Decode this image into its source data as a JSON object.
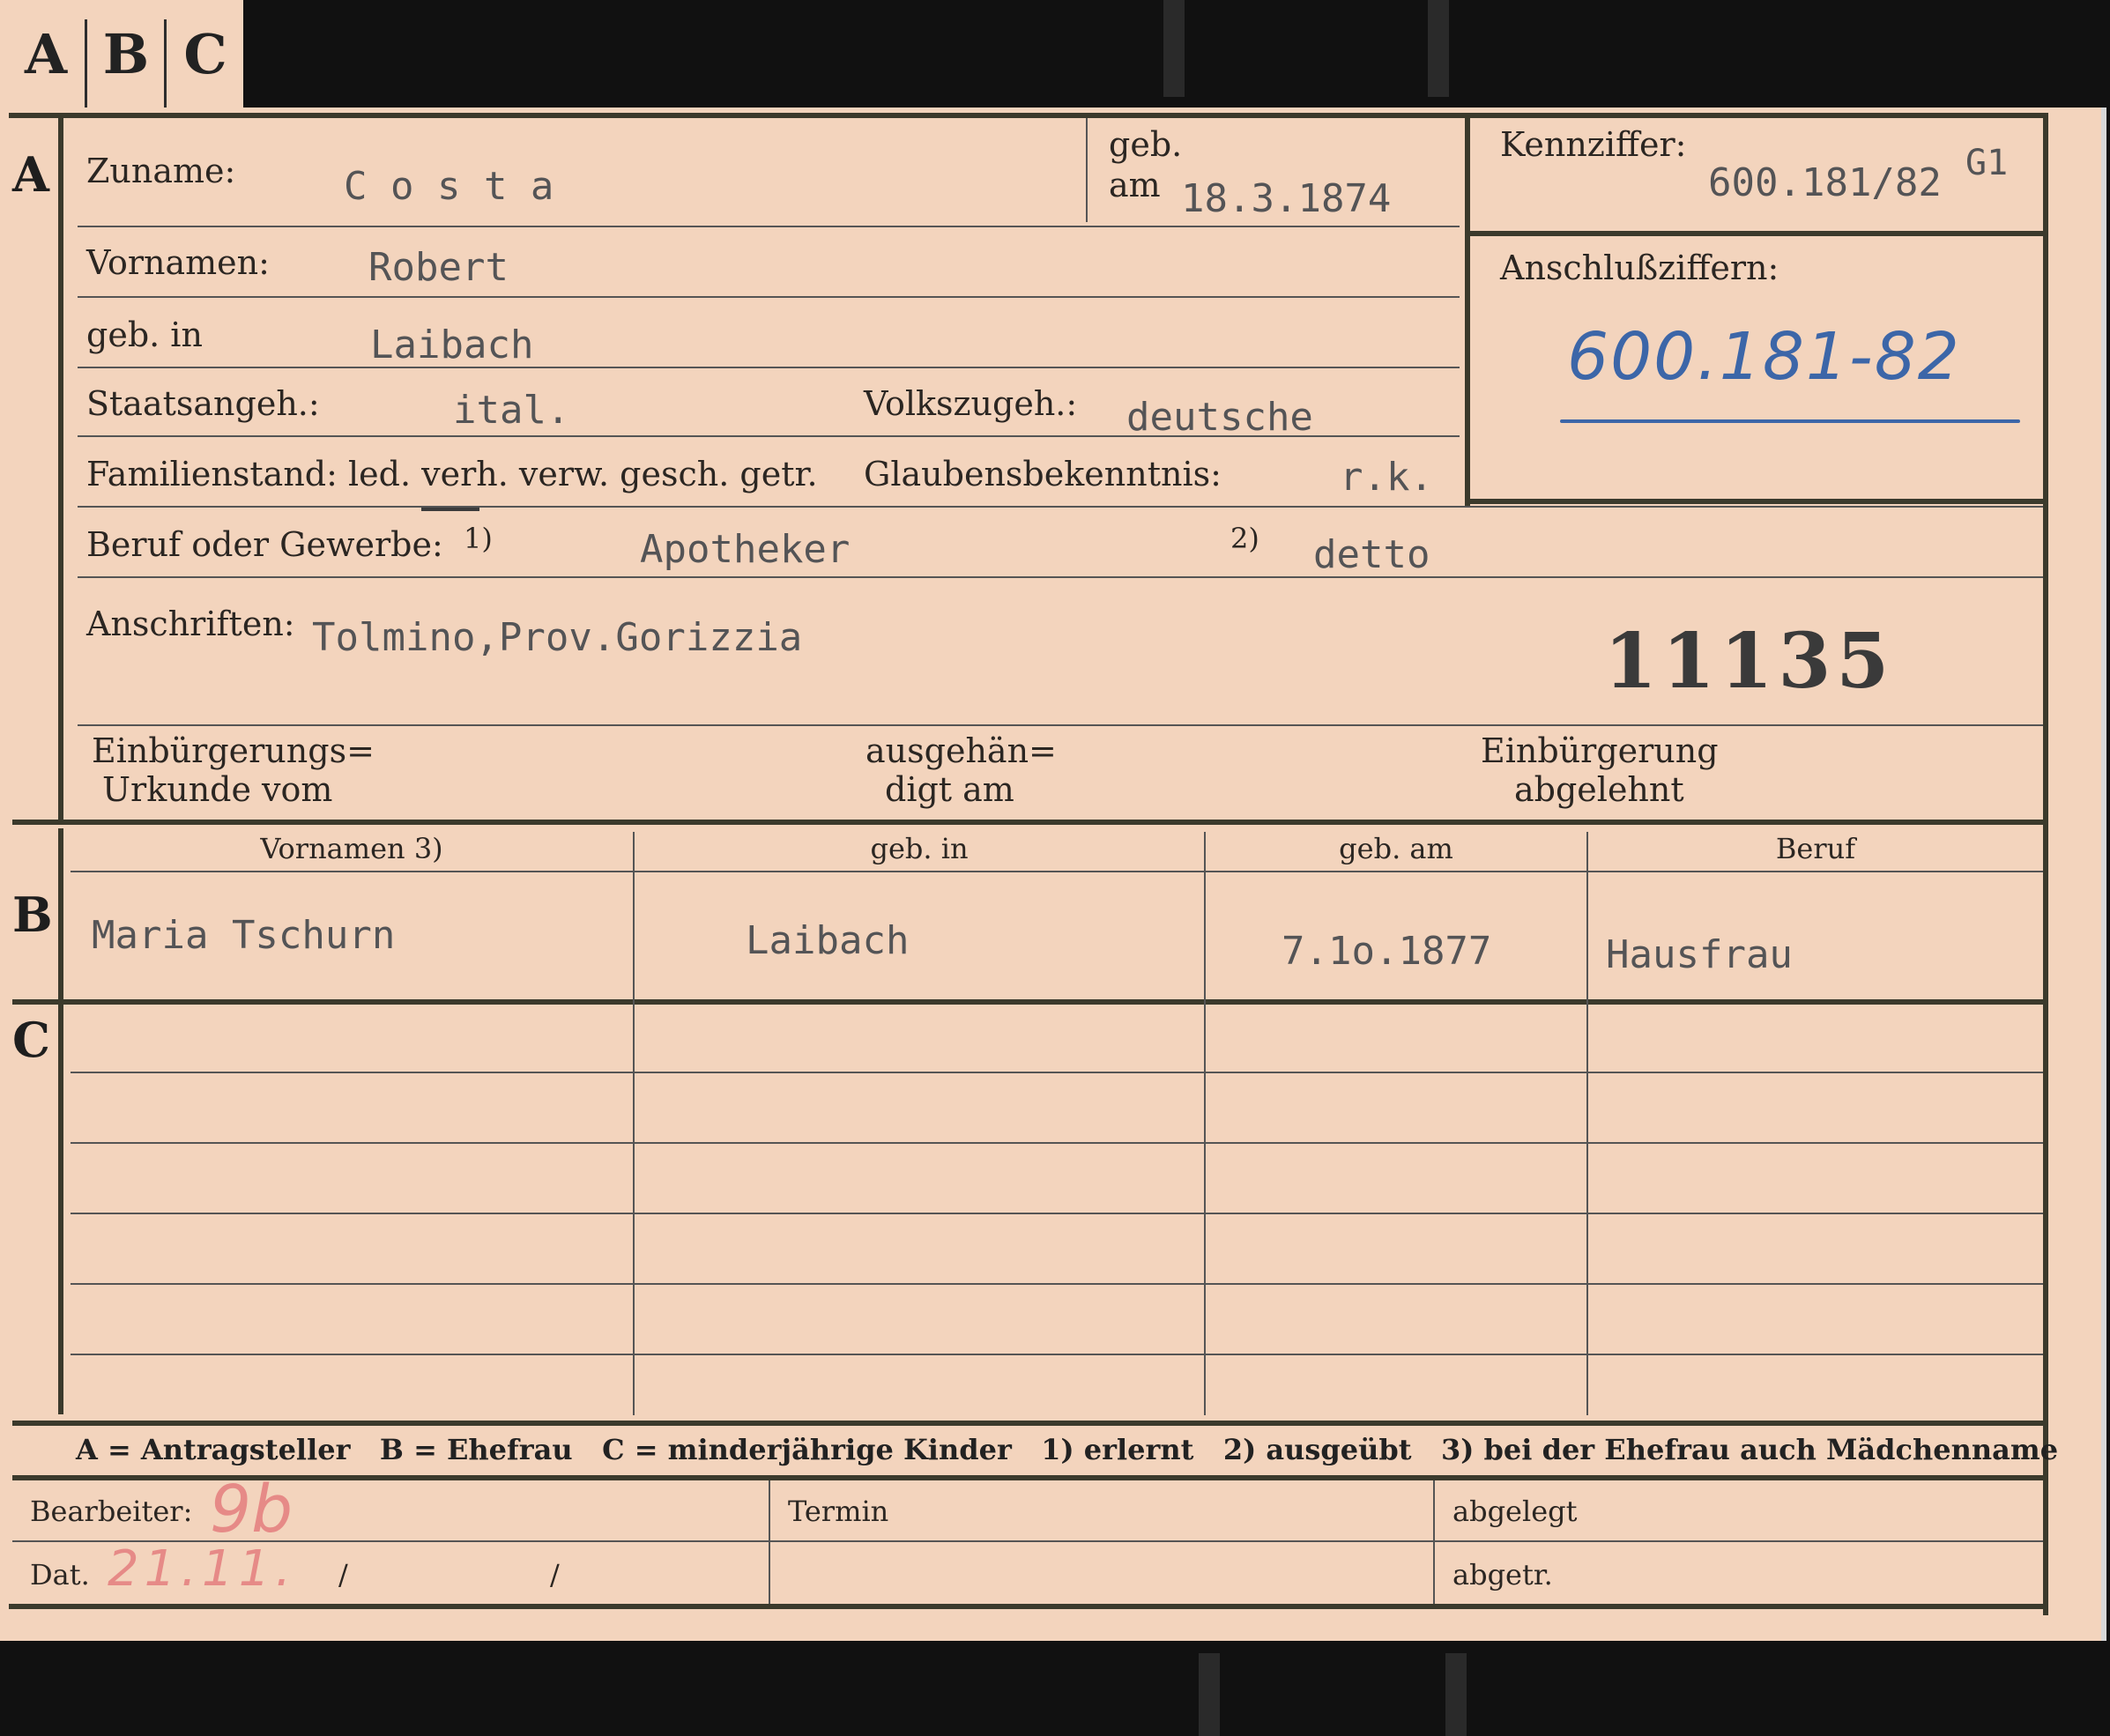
{
  "tabs": [
    "A",
    "B",
    "C"
  ],
  "sections": {
    "a": "A",
    "b": "B",
    "c": "C"
  },
  "labels": {
    "zuname": "Zuname:",
    "geb": "geb.",
    "am": "am",
    "kennziffer": "Kennziffer:",
    "vornamen": "Vornamen:",
    "anschlussziffern": "Anschlußziffern:",
    "geb_in": "geb. in",
    "staatsangeh": "Staatsangeh.:",
    "volkszugeh": "Volkszugeh.:",
    "familienstand": "Familienstand: led. verh. verw. gesch. getr.",
    "glaubensbekenntnis": "Glaubensbekenntnis:",
    "beruf": "Beruf oder Gewerbe:",
    "beruf_note1": "1)",
    "beruf_note2": "2)",
    "anschriften": "Anschriften:",
    "einbuergerungs_1": "Einbürgerungs=",
    "einbuergerungs_2": "Urkunde vom",
    "ausgehaen_1": "ausgehän=",
    "ausgehaen_2": "digt am",
    "abgelehnt_1": "Einbürgerung",
    "abgelehnt_2": "abgelehnt"
  },
  "applicant": {
    "surname": "C o s t a",
    "birth_date": "18.3.1874",
    "reference_number": "600.181/82",
    "reference_suffix": "G1",
    "linked_number": "600.181-82",
    "first_names": "Robert",
    "birthplace": "Laibach",
    "citizenship": "ital.",
    "ethnicity": "deutsche",
    "religion": "r.k.",
    "occupation_learned": "Apotheker",
    "occupation_practiced": "detto",
    "address": "Tolmino,Prov.Gorizzia",
    "stamp_number": "11135"
  },
  "family_table": {
    "headers": [
      "Vornamen 3)",
      "geb. in",
      "geb. am",
      "Beruf"
    ],
    "spouse": {
      "first_names": "Maria Tschurn",
      "birthplace": "Laibach",
      "birth_date": "7.1o.1877",
      "occupation": "Hausfrau"
    }
  },
  "legend": "A = Antragsteller   B = Ehefrau   C = minderjährige Kinder   1) erlernt   2) ausgeübt   3) bei der Ehefrau auch Mädchenname",
  "footer": {
    "bearbeiter": "Bearbeiter:",
    "bearbeiter_value": "9b",
    "dat": "Dat.",
    "dat_value": "21.11.",
    "slash": "/",
    "termin": "Termin",
    "abgelegt": "abgelegt",
    "abgetr": "abgetr."
  }
}
